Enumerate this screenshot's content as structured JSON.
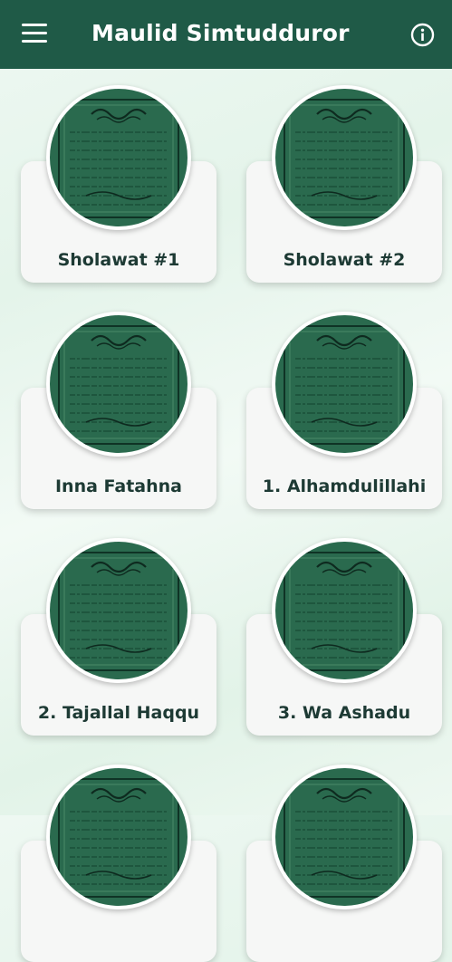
{
  "app": {
    "title": "Maulid Simtudduror"
  },
  "toolbar": {
    "menu_icon": "hamburger-menu-icon",
    "info_icon": "info-icon"
  },
  "items": [
    {
      "label": "Sholawat #1"
    },
    {
      "label": "Sholawat #2"
    },
    {
      "label": "Inna Fatahna"
    },
    {
      "label": "1. Alhamdulillahi"
    },
    {
      "label": "2. Tajallal Haqqu"
    },
    {
      "label": "3. Wa Ashadu"
    },
    {
      "label": ""
    },
    {
      "label": ""
    }
  ],
  "colors": {
    "appbar": "#1f5a47",
    "cover": "#2a6a4e",
    "card": "#f6f7f6",
    "label": "#1d3a34"
  }
}
